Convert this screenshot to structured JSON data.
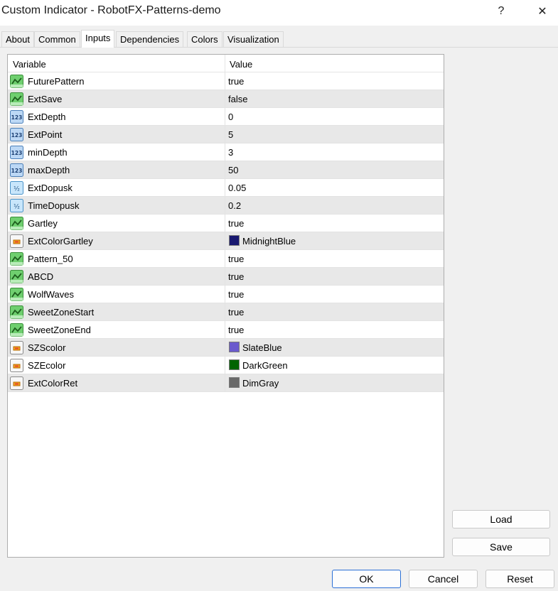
{
  "window": {
    "title": "Custom Indicator - RobotFX-Patterns-demo",
    "help_label": "?",
    "close_label": "✕"
  },
  "tabs": [
    {
      "label": "About"
    },
    {
      "label": "Common"
    },
    {
      "label": "Inputs"
    },
    {
      "label": "Dependencies"
    },
    {
      "label": "Colors"
    },
    {
      "label": "Visualization"
    }
  ],
  "active_tab": "Inputs",
  "table": {
    "col_variable": "Variable",
    "col_value": "Value",
    "rows": [
      {
        "type": "bool",
        "icon": "bool-icon",
        "name": "FuturePattern",
        "value": "true"
      },
      {
        "type": "bool",
        "icon": "bool-icon",
        "name": "ExtSave",
        "value": "false"
      },
      {
        "type": "int",
        "icon": "integer-icon",
        "name": "ExtDepth",
        "value": "0"
      },
      {
        "type": "int",
        "icon": "integer-icon",
        "name": "ExtPoint",
        "value": "5"
      },
      {
        "type": "int",
        "icon": "integer-icon",
        "name": "minDepth",
        "value": "3"
      },
      {
        "type": "int",
        "icon": "integer-icon",
        "name": "maxDepth",
        "value": "50"
      },
      {
        "type": "double",
        "icon": "fraction-icon",
        "name": "ExtDopusk",
        "value": "0.05"
      },
      {
        "type": "double",
        "icon": "fraction-icon",
        "name": "TimeDopusk",
        "value": "0.2"
      },
      {
        "type": "bool",
        "icon": "bool-icon",
        "name": "Gartley",
        "value": "true"
      },
      {
        "type": "color",
        "icon": "color-icon",
        "name": "ExtColorGartley",
        "value": "MidnightBlue",
        "color": "#191970"
      },
      {
        "type": "bool",
        "icon": "bool-icon",
        "name": "Pattern_50",
        "value": "true"
      },
      {
        "type": "bool",
        "icon": "bool-icon",
        "name": "ABCD",
        "value": "true"
      },
      {
        "type": "bool",
        "icon": "bool-icon",
        "name": "WolfWaves",
        "value": "true"
      },
      {
        "type": "bool",
        "icon": "bool-icon",
        "name": "SweetZoneStart",
        "value": "true"
      },
      {
        "type": "bool",
        "icon": "bool-icon",
        "name": "SweetZoneEnd",
        "value": "true"
      },
      {
        "type": "color",
        "icon": "color-icon",
        "name": "SZScolor",
        "value": "SlateBlue",
        "color": "#6a5acd"
      },
      {
        "type": "color",
        "icon": "color-icon",
        "name": "SZEcolor",
        "value": "DarkGreen",
        "color": "#006400"
      },
      {
        "type": "color",
        "icon": "color-icon",
        "name": "ExtColorRet",
        "value": "DimGray",
        "color": "#696969"
      }
    ]
  },
  "side_buttons": {
    "load": "Load",
    "save": "Save"
  },
  "footer": {
    "ok": "OK",
    "cancel": "Cancel",
    "reset": "Reset"
  },
  "colors": {
    "accent": "#2a6fd6",
    "row_alt": "#e8e8e8"
  }
}
